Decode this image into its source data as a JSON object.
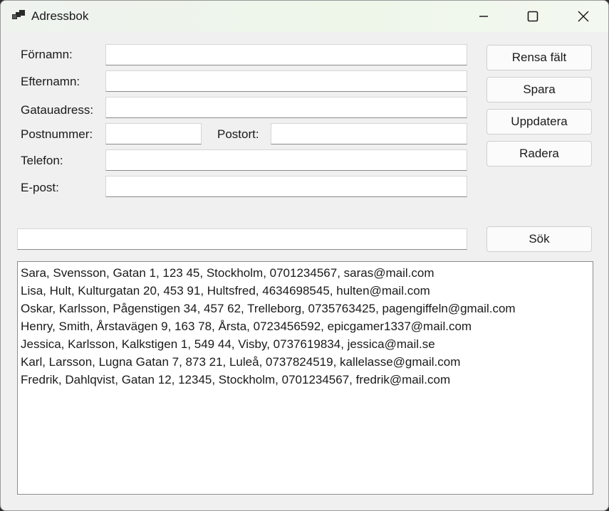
{
  "window": {
    "title": "Adressbok",
    "icon": "app-window-icon",
    "controls": [
      "minimize-icon",
      "maximize-icon",
      "close-icon"
    ]
  },
  "form": {
    "first_name_label": "Förnamn:",
    "first_name_value": "",
    "last_name_label": "Efternamn:",
    "last_name_value": "",
    "street_label": "Gatauadress:",
    "street_value": "",
    "postal_code_label": "Postnummer:",
    "postal_code_value": "",
    "city_label": "Postort:",
    "city_value": "",
    "phone_label": "Telefon:",
    "phone_value": "",
    "email_label": "E-post:",
    "email_value": ""
  },
  "buttons": {
    "clear": "Rensa fält",
    "save": "Spara",
    "update": "Uppdatera",
    "delete": "Radera",
    "search": "Sök"
  },
  "search": {
    "value": ""
  },
  "list": {
    "items": [
      "Sara, Svensson, Gatan 1, 123 45, Stockholm, 0701234567, saras@mail.com",
      "Lisa, Hult, Kulturgatan 20, 453 91, Hultsfred, 4634698545, hulten@mail.com",
      "Oskar, Karlsson, Pågenstigen 34, 457 62, Trelleborg, 0735763425, pagengiffeln@gmail.com",
      "Henry, Smith, Årstavägen 9, 163 78, Årsta, 0723456592, epicgamer1337@mail.com",
      "Jessica, Karlsson, Kalkstigen 1, 549 44, Visby, 0737619834, jessica@mail.se",
      "Karl, Larsson, Lugna Gatan 7, 873 21, Luleå, 0737824519, kallelasse@gmail.com",
      "Fredrik, Dahlqvist, Gatan 12, 12345, Stockholm, 0701234567, fredrik@mail.com"
    ]
  }
}
